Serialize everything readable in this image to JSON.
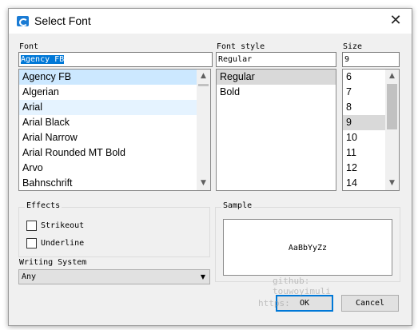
{
  "window": {
    "title": "Select Font",
    "close_glyph": "✕"
  },
  "font": {
    "label": "Font",
    "value": "Agency FB",
    "items": [
      "Agency FB",
      "Algerian",
      "Arial",
      "Arial Black",
      "Arial Narrow",
      "Arial Rounded MT Bold",
      "Arvo",
      "Bahnschrift"
    ]
  },
  "style": {
    "label": "Font style",
    "value": "Regular",
    "items": [
      "Regular",
      "Bold"
    ]
  },
  "size": {
    "label": "Size",
    "value": "9",
    "items": [
      "6",
      "7",
      "8",
      "9",
      "10",
      "11",
      "12",
      "14"
    ]
  },
  "effects": {
    "label": "Effects",
    "strikeout_label": "Strikeout",
    "underline_label": "Underline"
  },
  "sample": {
    "label": "Sample",
    "text": "AaBbYyZz"
  },
  "writing_system": {
    "label": "Writing System",
    "value": "Any"
  },
  "buttons": {
    "ok": "OK",
    "cancel": "Cancel"
  },
  "watermark": {
    "line1": "github:",
    "line2": "touwoyimuli",
    "line3": "https:"
  },
  "icons": {
    "up": "▲",
    "down": "▼",
    "combo": "▼"
  }
}
